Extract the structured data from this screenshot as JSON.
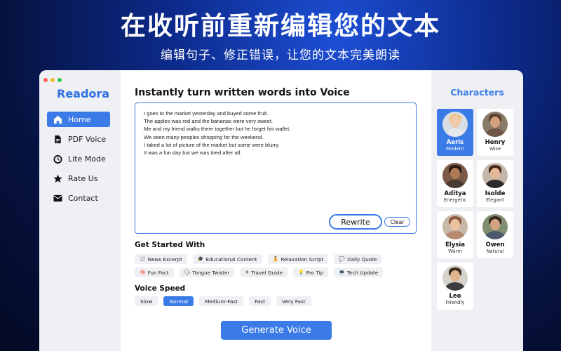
{
  "promo": {
    "title": "在收听前重新编辑您的文本",
    "subtitle": "编辑句子、修正错误，让您的文本完美朗读"
  },
  "app": {
    "name": "Readora"
  },
  "sidebar": {
    "items": [
      {
        "label": "Home",
        "icon": "home-icon",
        "active": true
      },
      {
        "label": "PDF Voice",
        "icon": "document-icon",
        "active": false
      },
      {
        "label": "Lite Mode",
        "icon": "timer-icon",
        "active": false
      },
      {
        "label": "Rate Us",
        "icon": "star-icon",
        "active": false
      },
      {
        "label": "Contact",
        "icon": "mail-icon",
        "active": false
      }
    ]
  },
  "main": {
    "title": "Instantly turn written words into Voice",
    "editor_text": "I goes to the market yesterday and buyed some fruit.\nThe apples was red and the bananas were very sweet.\nMe and my friend walks there together but he forget his wallet.\nWe seen many peoples shopping for the weekend.\nI taked a lot of picture of the market but some were blurry.\nIt was a fun day but we was tired after all.",
    "rewrite_label": "Rewrite",
    "clear_label": "Clear",
    "get_started_heading": "Get Started With",
    "chips_row1": [
      {
        "emoji": "📰",
        "label": "News Excerpt"
      },
      {
        "emoji": "🎓",
        "label": "Educational Content"
      },
      {
        "emoji": "🧘",
        "label": "Relaxation Script"
      },
      {
        "emoji": "💬",
        "label": "Daily Quote"
      }
    ],
    "chips_row2": [
      {
        "emoji": "🧠",
        "label": "Fun Fact"
      },
      {
        "emoji": "🗣",
        "label": "Tongue Twister"
      },
      {
        "emoji": "✈",
        "label": "Travel Guide"
      },
      {
        "emoji": "💡",
        "label": "Pro Tip"
      },
      {
        "emoji": "💻",
        "label": "Tech Update"
      }
    ],
    "voice_speed_heading": "Voice Speed",
    "speeds": [
      {
        "label": "Slow",
        "active": false
      },
      {
        "label": "Normal",
        "active": true
      },
      {
        "label": "Medium-Fast",
        "active": false
      },
      {
        "label": "Fast",
        "active": false
      },
      {
        "label": "Very Fast",
        "active": false
      }
    ],
    "generate_label": "Generate Voice"
  },
  "characters": {
    "heading": "Characters",
    "list": [
      {
        "name": "Aeris",
        "desc": "Modern",
        "active": true
      },
      {
        "name": "Henry",
        "desc": "Wise",
        "active": false
      },
      {
        "name": "Aditya",
        "desc": "Energetic",
        "active": false
      },
      {
        "name": "Isolde",
        "desc": "Elegant",
        "active": false
      },
      {
        "name": "Elysia",
        "desc": "Warm",
        "active": false
      },
      {
        "name": "Owen",
        "desc": "Natural",
        "active": false
      },
      {
        "name": "Leo",
        "desc": "Friendly",
        "active": false
      }
    ]
  },
  "colors": {
    "accent": "#3b7be8",
    "sidebar_bg": "#eef0f4"
  }
}
